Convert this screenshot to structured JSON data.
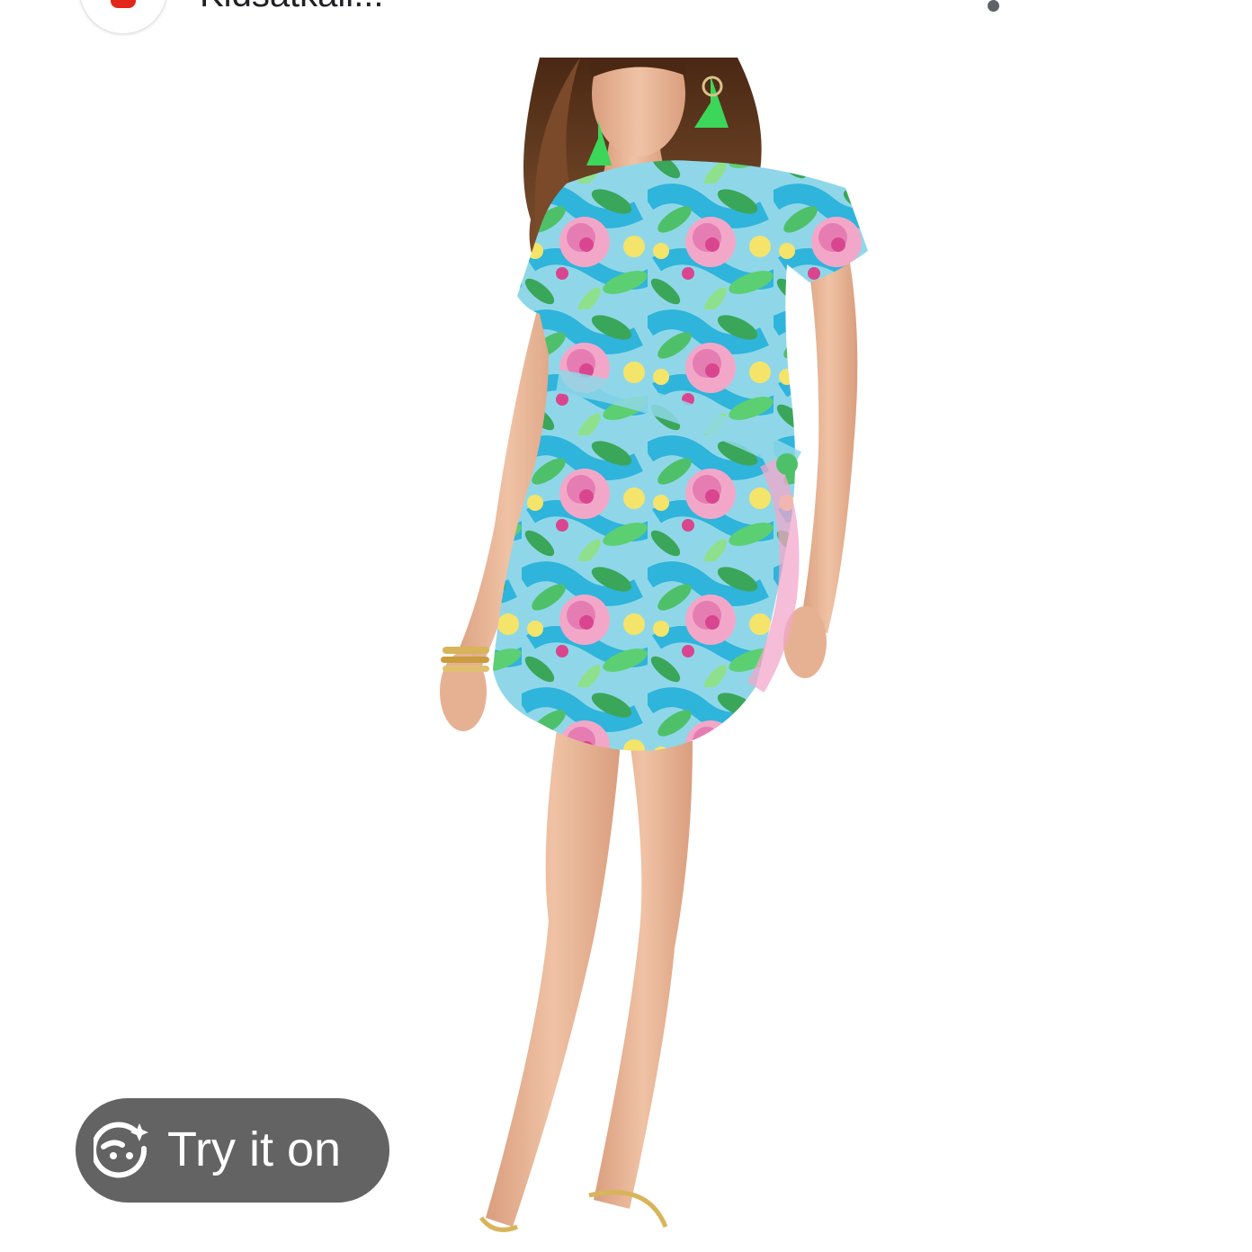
{
  "header": {
    "source_name": "Kidsatkali...",
    "logo_icon": "source-logo-icon",
    "more_icon": "more-vert-icon",
    "close_icon": "close-icon"
  },
  "product": {
    "image_subject": "model wearing floral print short sleeve wrap mini dress",
    "palette": {
      "turquoise": "#2fb4dc",
      "leaf_green": "#4fc06a",
      "pink": "#f2a7c9",
      "magenta": "#d9468f",
      "yellow": "#f4e46a",
      "skin": "#e9b596",
      "hair": "#6b3d22"
    }
  },
  "try_on": {
    "label": "Try it on",
    "icon": "face-sparkle-icon",
    "background": "#636363",
    "text_color": "#ffffff"
  }
}
